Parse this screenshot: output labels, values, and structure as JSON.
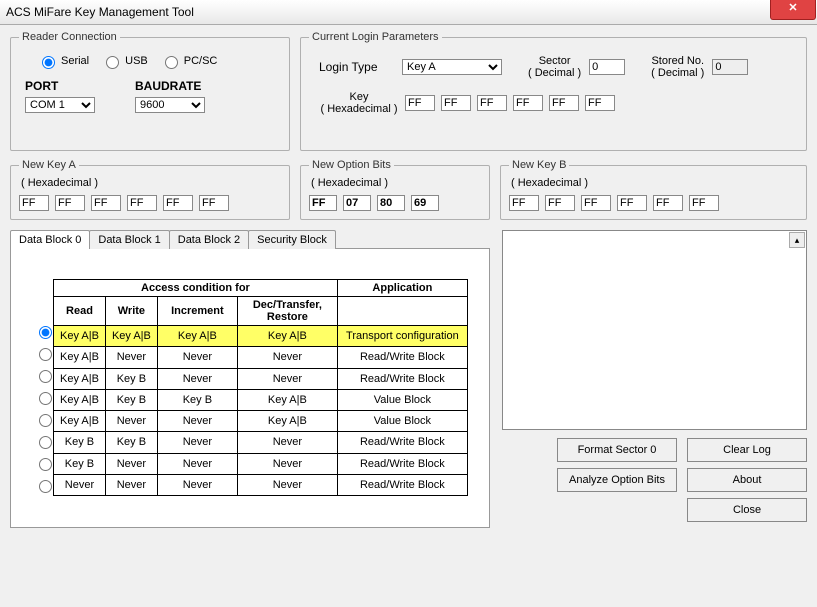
{
  "title": "ACS MiFare Key Management Tool",
  "reader_connection": {
    "legend": "Reader Connection",
    "options": {
      "serial": "Serial",
      "usb": "USB",
      "pcsc": "PC/SC"
    },
    "port_label": "PORT",
    "baud_label": "BAUDRATE",
    "port_value": "COM 1",
    "baud_value": "9600"
  },
  "login": {
    "legend": "Current Login Parameters",
    "type_label": "Login Type",
    "type_value": "Key A",
    "sector_label": "Sector",
    "decimal": "( Decimal )",
    "sector_value": "0",
    "stored_label": "Stored No.",
    "stored_value": "0",
    "key_label": "Key",
    "hex_label": "( Hexadecimal )",
    "key": [
      "FF",
      "FF",
      "FF",
      "FF",
      "FF",
      "FF"
    ]
  },
  "new_key_a": {
    "legend": "New Key A",
    "hex_label": "( Hexadecimal )",
    "vals": [
      "FF",
      "FF",
      "FF",
      "FF",
      "FF",
      "FF"
    ]
  },
  "option_bits": {
    "legend": "New Option Bits",
    "hex_label": "( Hexadecimal )",
    "vals": [
      "FF",
      "07",
      "80",
      "69"
    ]
  },
  "new_key_b": {
    "legend": "New Key B",
    "hex_label": "( Hexadecimal )",
    "vals": [
      "FF",
      "FF",
      "FF",
      "FF",
      "FF",
      "FF"
    ]
  },
  "tabs": [
    "Data Block 0",
    "Data Block 1",
    "Data Block 2",
    "Security Block"
  ],
  "table": {
    "group_access": "Access condition for",
    "group_app": "Application",
    "cols": [
      "Read",
      "Write",
      "Increment",
      "Dec/Transfer, Restore"
    ],
    "rows": [
      {
        "sel": true,
        "r": "Key A|B",
        "w": "Key A|B",
        "i": "Key A|B",
        "d": "Key A|B",
        "app": "Transport configuration"
      },
      {
        "sel": false,
        "r": "Key A|B",
        "w": "Never",
        "i": "Never",
        "d": "Never",
        "app": "Read/Write Block"
      },
      {
        "sel": false,
        "r": "Key A|B",
        "w": "Key B",
        "i": "Never",
        "d": "Never",
        "app": "Read/Write Block"
      },
      {
        "sel": false,
        "r": "Key A|B",
        "w": "Key B",
        "i": "Key B",
        "d": "Key A|B",
        "app": "Value Block"
      },
      {
        "sel": false,
        "r": "Key A|B",
        "w": "Never",
        "i": "Never",
        "d": "Key A|B",
        "app": "Value Block"
      },
      {
        "sel": false,
        "r": "Key B",
        "w": "Key B",
        "i": "Never",
        "d": "Never",
        "app": "Read/Write Block"
      },
      {
        "sel": false,
        "r": "Key B",
        "w": "Never",
        "i": "Never",
        "d": "Never",
        "app": "Read/Write Block"
      },
      {
        "sel": false,
        "r": "Never",
        "w": "Never",
        "i": "Never",
        "d": "Never",
        "app": "Read/Write Block"
      }
    ]
  },
  "buttons": {
    "format": "Format Sector 0",
    "clear": "Clear Log",
    "analyze": "Analyze Option Bits",
    "about": "About",
    "close": "Close"
  }
}
